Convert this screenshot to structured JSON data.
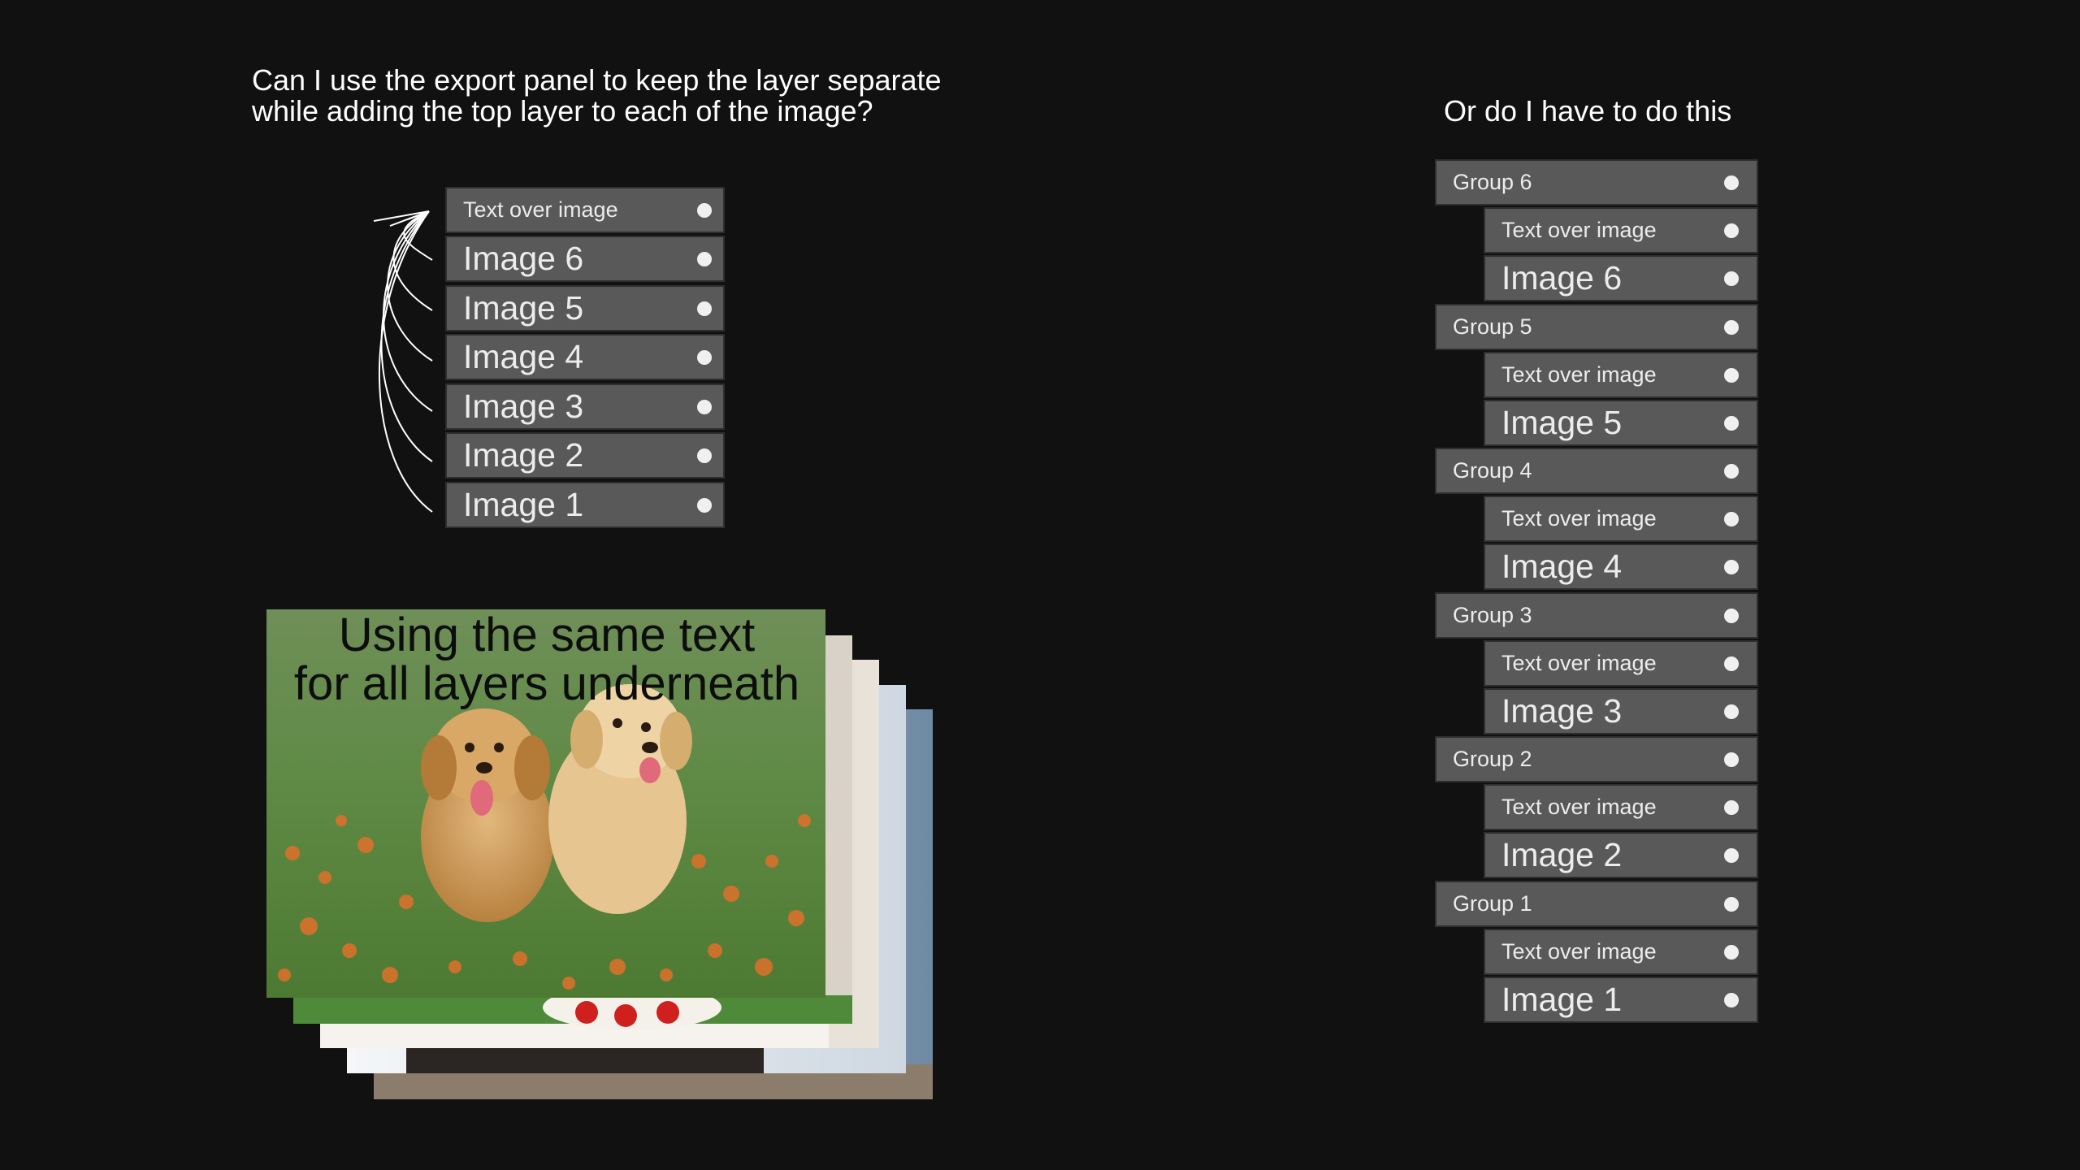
{
  "question": {
    "line1": "Can I use the export panel to keep the layer separate",
    "line2": "while adding the top layer to each of the image?"
  },
  "right_title": "Or do I have to do this",
  "left_panel": {
    "layers": [
      {
        "label": "Text over image"
      },
      {
        "label": "Image 6"
      },
      {
        "label": "Image 5"
      },
      {
        "label": "Image 4"
      },
      {
        "label": "Image 3"
      },
      {
        "label": "Image 2"
      },
      {
        "label": "Image 1"
      }
    ]
  },
  "right_panel": {
    "groups": [
      {
        "label": "Group 6",
        "text_layer": "Text over image",
        "image_layer": "Image 6"
      },
      {
        "label": "Group 5",
        "text_layer": "Text over image",
        "image_layer": "Image 5"
      },
      {
        "label": "Group 4",
        "text_layer": "Text over image",
        "image_layer": "Image 4"
      },
      {
        "label": "Group 3",
        "text_layer": "Text over image",
        "image_layer": "Image 3"
      },
      {
        "label": "Group 2",
        "text_layer": "Text over image",
        "image_layer": "Image 2"
      },
      {
        "label": "Group 1",
        "text_layer": "Text over image",
        "image_layer": "Image 1"
      }
    ]
  },
  "photo_caption": {
    "line1": "Using the same text",
    "line2": "for all layers underneath"
  },
  "colors": {
    "background": "#111111",
    "layer_fill": "#595959",
    "layer_border": "#2e2e2e",
    "layer_text": "#ececec",
    "visibility_dot": "#f0f0f0"
  }
}
